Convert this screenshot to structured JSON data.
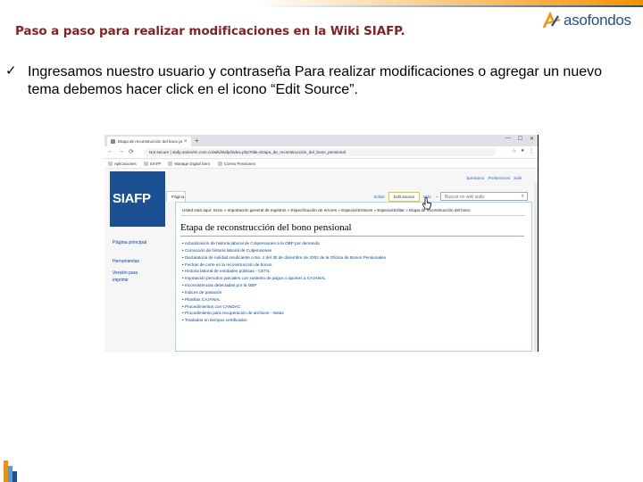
{
  "slide": {
    "title": "Paso a paso para realizar modificaciones en la Wiki SIAFP.",
    "bullet_mark": "ü",
    "bullet_text": "Ingresamos nuestro usuario y contraseña Para realizar modificaciones o agregar un nuevo tema debemos hacer click en el icono “Edit Source”.",
    "logo_text": "asofondos",
    "colors": {
      "title": "#8a1f1f",
      "logo_blue": "#1f4e9b",
      "logo_orange": "#f39200"
    }
  },
  "browser": {
    "tab_title": "Etapa de reconstrucción del bono pensional",
    "url": "Not secure | siafp.saireohn.com.co/wiki/siafp/index.php?title=Etapa_de_reconstrucción_del_bono_pensional",
    "bookmarks": [
      "Aplicaciones",
      "SIAFP",
      "Manage Digital Serv.",
      "Correo Pensiones"
    ]
  },
  "wiki": {
    "logo_text": "SIAFP",
    "user_links": [
      "Jperdomo",
      "Preferences",
      "Salir"
    ],
    "page_tab": "Página",
    "action_tabs": {
      "read": "Editar",
      "edit_source": "Edit source",
      "more": "Más"
    },
    "search_placeholder": "Buscar en wiki siafp",
    "breadcrumbs": "Usted está aquí: Inicio » Importación general de registros » Especificación de errores » Especial:Enlaces » Especial:Editar » Etapa de reconstrucción del bono",
    "heading": "Etapa de reconstrucción del bono pensional",
    "sidebar": {
      "main_page": "Página principal",
      "tools": "Herramientas",
      "printable": "Versión para imprimir"
    },
    "toc": [
      "Actualización de historia laboral de Colpensiones a la OBP por demanda",
      "Corrección de historia laboral de Colpensiones",
      "Declaratoria de nulidad insuficiente o No. 1 del 30 de diciembre de 2002 de la Oficina de Bonos Pensionales",
      "Fechas de corte en la reconstrucción de bonos",
      "Historia laboral de entidades públicas - CETIL",
      "Imputación periodos parciales con sustento de pagos o aportes a CAJANAL",
      "Inconsistencias detectadas por la OBP",
      "Índices de pasación",
      "Planillas CAJANAL",
      "Procedimientos con CANDAC",
      "Procedimiento para recuperación de archivos - Notas",
      "Traslados en tiempos certificados"
    ]
  }
}
